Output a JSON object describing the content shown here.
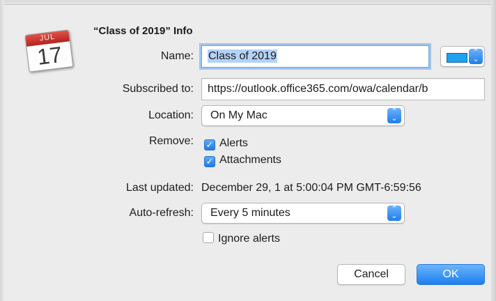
{
  "dialog": {
    "title": "“Class of 2019” Info",
    "icon": {
      "name": "calendar-icon",
      "month": "JUL",
      "day": "17"
    }
  },
  "name_field": {
    "label": "Name:",
    "value": "Class of 2019"
  },
  "color_picker": {
    "swatch_color": "#1ea3f0"
  },
  "subscribed_field": {
    "label": "Subscribed to:",
    "value": "https://outlook.office365.com/owa/calendar/b"
  },
  "location": {
    "label": "Location:",
    "value": "On My Mac"
  },
  "remove": {
    "label": "Remove:",
    "options": [
      {
        "label": "Alerts",
        "checked": true
      },
      {
        "label": "Attachments",
        "checked": true
      }
    ]
  },
  "last_updated": {
    "label": "Last updated:",
    "value": "December 29, 1 at 5:00:04 PM GMT-6:59:56"
  },
  "auto_refresh": {
    "label": "Auto-refresh:",
    "value": "Every 5 minutes"
  },
  "ignore_alerts": {
    "label": "Ignore alerts",
    "checked": false
  },
  "buttons": {
    "cancel": "Cancel",
    "ok": "OK"
  },
  "colors": {
    "accent": "#1d7ceb",
    "focus_ring": "#9fc4ee"
  }
}
